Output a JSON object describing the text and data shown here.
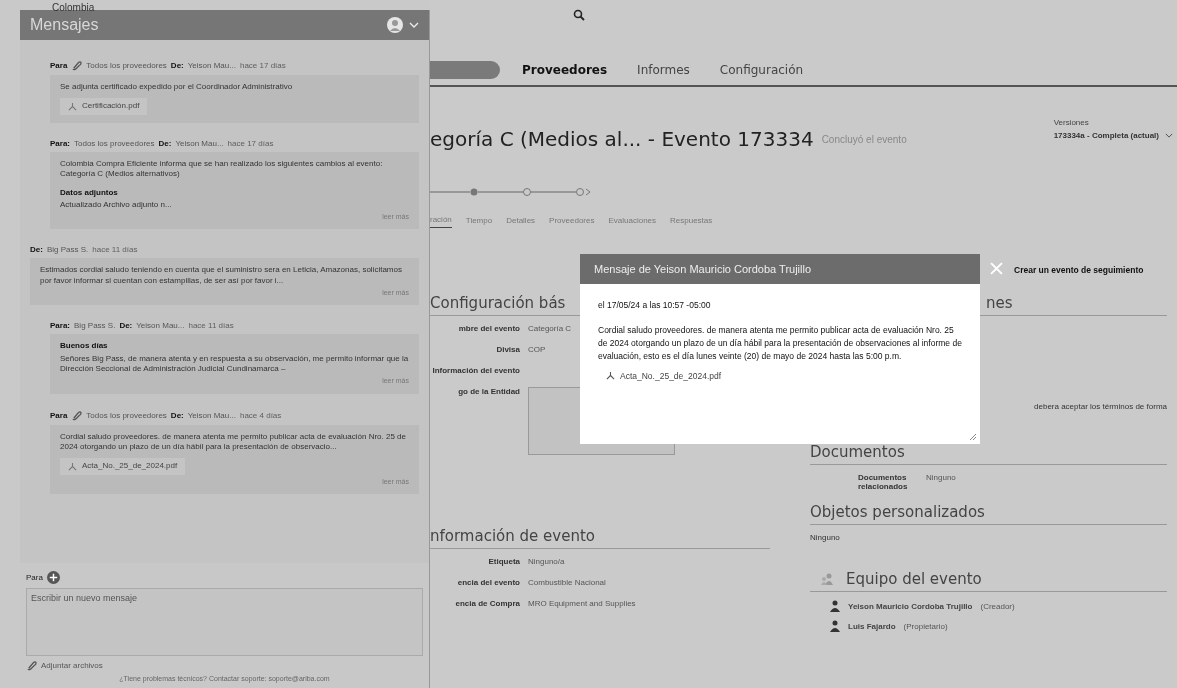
{
  "header": {
    "brand": "Colombia",
    "tabs": [
      {
        "label": "Proveedores",
        "selected": true
      },
      {
        "label": "Informes",
        "selected": false
      },
      {
        "label": "Configuración",
        "selected": false
      }
    ]
  },
  "messages_panel": {
    "title": "Mensajes",
    "messages": [
      {
        "kind": "outgoing",
        "to_label": "Para",
        "clip": true,
        "to": "Todos los proveedores",
        "from_label": "De:",
        "from": "Yeison Mau...",
        "time": "hace 17 días",
        "body": "Se adjunta certificado expedido por el Coordinador Administrativo",
        "attachment": "Certificación.pdf"
      },
      {
        "kind": "outgoing",
        "to_label": "Para:",
        "clip": false,
        "to": "Todos los proveedores",
        "from_label": "De:",
        "from": "Yeison Mau...",
        "time": "hace 17 días",
        "body": "Colombia Compra Eficiente informa que se han realizado los siguientes cambios al evento: Categoría C (Medios alternativos)",
        "section_title": "Datos adjuntos",
        "section_text": "Actualizado Archivo adjunto n...",
        "more": "leer más"
      },
      {
        "kind": "incoming",
        "from_label": "De:",
        "from": "Big Pass S.",
        "time": "hace 11 días",
        "body": "Estimados cordial saludo teniendo en cuenta que el suministro sera en Leticia, Amazonas, solicitamos por favor informar si cuentan con estampillas, de ser así por favor i...",
        "more": "leer más"
      },
      {
        "kind": "outgoing",
        "to_label": "Para:",
        "clip": false,
        "to": "Big Pass S.",
        "from_label": "De:",
        "from": "Yeison Mau...",
        "time": "hace 11 días",
        "greeting": "Buenos días",
        "body": "Señores Big Pass, de manera atenta y en respuesta a su observación, me permito informar que la Dirección Seccional de Administración Judicial Cundinamarca –",
        "more": "leer más"
      },
      {
        "kind": "outgoing",
        "to_label": "Para",
        "clip": true,
        "to": "Todos los proveedores",
        "from_label": "De:",
        "from": "Yeison Mau...",
        "time": "hace 4 días",
        "body": "Cordial saludo proveedores. de manera atenta me permito publicar acta de evaluación Nro. 25 de 2024 otorgando un plazo de un día hábil para la presentación de observacio...",
        "attachment": "Acta_No._25_de_2024.pdf",
        "more": "leer más"
      }
    ],
    "compose": {
      "to_label": "Para",
      "placeholder": "Escribir un nuevo mensaje",
      "attach": "Adjuntar archivos",
      "footer": "¿Tiene problemas técnicos? Contactar soporte: soporte@ariba.com"
    }
  },
  "event": {
    "title": "egoría C (Medios al... - Evento 173334",
    "status": "Concluyó el evento",
    "versions_label": "Versiones",
    "version": "173334a - Completa (actual)",
    "subtabs": [
      {
        "label": "ración",
        "selected": true
      },
      {
        "label": "Tiempo",
        "selected": false
      },
      {
        "label": "Detalles",
        "selected": false
      },
      {
        "label": "Proveedores",
        "selected": false
      },
      {
        "label": "Evaluaciones",
        "selected": false
      },
      {
        "label": "Respuestas",
        "selected": false
      }
    ]
  },
  "basic_config": {
    "title": "Configuración bás",
    "rows": [
      {
        "label": "mbre del evento",
        "value": "Categoría C"
      },
      {
        "label": "Divisa",
        "value": "COP"
      },
      {
        "label": "Información del evento",
        "value": ""
      }
    ],
    "logo_label": "go de la Entidad"
  },
  "event_info": {
    "title": "nformación de evento",
    "rows": [
      {
        "label": "Etiqueta",
        "value": "Ninguno/a"
      },
      {
        "label": "encia del evento",
        "value": "Combustible Nacional"
      },
      {
        "label": "encia de Compra",
        "value": "MRO Equipment and Supplies"
      }
    ]
  },
  "right_col": {
    "title": "nes",
    "terms": "debera aceptar los términos de forma",
    "documents_title": "Documentos",
    "documents_label": "Documentos relacionados",
    "documents_value": "Ninguno",
    "custom_title": "Objetos personalizados",
    "custom_value": "Ninguno",
    "team_title": "Equipo del evento",
    "team": [
      {
        "name": "Yeison Mauricio Cordoba Trujillo",
        "role": "(Creador)"
      },
      {
        "name": "Luis Fajardo",
        "role": "(Propietario)"
      }
    ]
  },
  "modal": {
    "title": "Mensaje de Yeison Mauricio Cordoba Trujillo",
    "link": "Crear un evento de seguimiento",
    "date": "el 17/05/24 a las 10:57 -05:00",
    "body": "Cordial saludo proveedores. de manera atenta me permito publicar acta de evaluación Nro. 25 de 2024 otorgando un plazo de un día hábil para la presentación de observaciones al informe de evaluación, esto es el día lunes veinte (20) de mayo de 2024 hasta las 5:00 p.m.",
    "attachment": "Acta_No._25_de_2024.pdf"
  }
}
